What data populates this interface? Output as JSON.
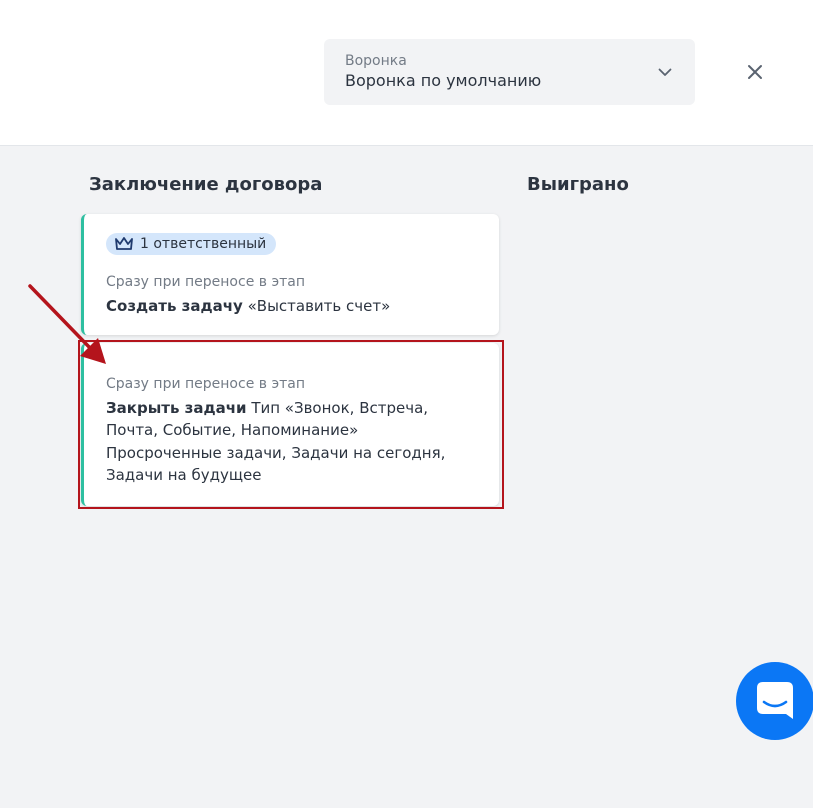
{
  "header": {
    "funnel_select": {
      "label": "Воронка",
      "value": "Воронка по умолчанию",
      "icon": "chevron-down-icon"
    },
    "close_icon": "close-icon"
  },
  "board": {
    "columns": [
      {
        "title": "Заключение договора",
        "cards": [
          {
            "badge": {
              "icon": "crown-icon",
              "text": "1 ответственный"
            },
            "trigger": "Сразу при переносе в этап",
            "action_bold": "Создать задачу",
            "action_rest": " «Выставить счет»"
          },
          {
            "trigger": "Сразу при переносе в этап",
            "action_bold": "Закрыть задачи",
            "action_rest": " Тип «Звонок, Встреча, Почта, Событие, Напоминание»",
            "extra": "Просроченные задачи, Задачи на сегодня, Задачи на будущее"
          }
        ]
      },
      {
        "title": "Выиграно",
        "cards": []
      }
    ]
  },
  "chat_button": {
    "icon": "chat-icon"
  },
  "colors": {
    "accent_border": "#2ebfa1",
    "badge_bg": "#d4e6fb",
    "highlight": "#b4141c",
    "chat": "#0b77f5",
    "board_bg": "#f2f3f5"
  }
}
